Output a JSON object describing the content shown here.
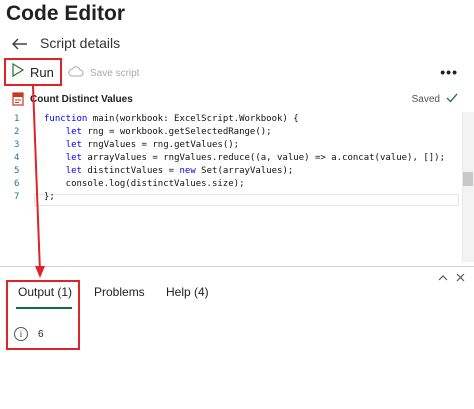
{
  "app": {
    "title": "Code Editor"
  },
  "header": {
    "subtitle": "Script details"
  },
  "toolbar": {
    "run_label": "Run",
    "save_label": "Save script",
    "more_label": "•••"
  },
  "file": {
    "name": "Count Distinct Values",
    "status": "Saved"
  },
  "editor": {
    "line_numbers": [
      "1",
      "2",
      "3",
      "4",
      "5",
      "6",
      "7"
    ],
    "lines": [
      "function main(workbook: ExcelScript.Workbook) {",
      "    let rng = workbook.getSelectedRange();",
      "    let rngValues = rng.getValues();",
      "    let arrayValues = rngValues.reduce((a, value) => a.concat(value), []);",
      "    let distinctValues = new Set(arrayValues);",
      "    console.log(distinctValues.size);",
      "};"
    ]
  },
  "panel": {
    "tabs": [
      {
        "label": "Output (1)"
      },
      {
        "label": "Problems"
      },
      {
        "label": "Help (4)"
      }
    ],
    "output_value": "6"
  },
  "colors": {
    "accent": "#e0232a",
    "tab_underline": "#0f6f3f",
    "keyword": "#0000ff"
  },
  "icons": [
    "back-arrow-icon",
    "play-icon",
    "cloud-save-icon",
    "more-icon",
    "script-file-icon",
    "checkmark-icon",
    "info-icon",
    "chevron-up-icon",
    "close-icon"
  ]
}
